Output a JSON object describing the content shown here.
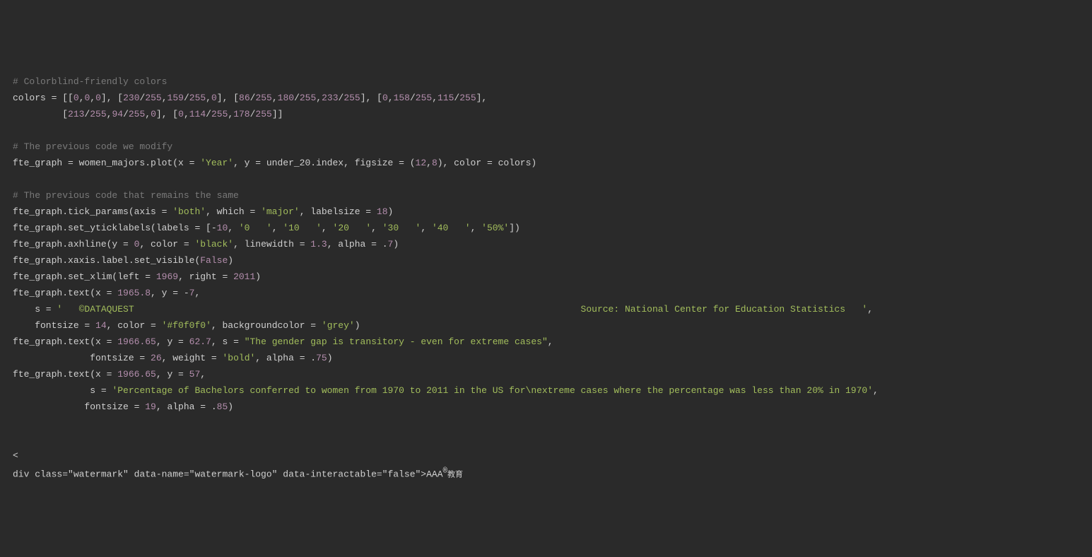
{
  "code": {
    "c1": "# Colorblind-friendly colors",
    "l2_a": "colors = [[",
    "l2_n1": "0",
    "l2_c1": ",",
    "l2_n2": "0",
    "l2_c2": ",",
    "l2_n3": "0",
    "l2_b": "], [",
    "l2_n4": "230",
    "l2_s1": "/",
    "l2_n5": "255",
    "l2_c3": ",",
    "l2_n6": "159",
    "l2_s2": "/",
    "l2_n7": "255",
    "l2_c4": ",",
    "l2_n8": "0",
    "l2_d": "], [",
    "l2_n9": "86",
    "l2_s3": "/",
    "l2_n10": "255",
    "l2_c5": ",",
    "l2_n11": "180",
    "l2_s4": "/",
    "l2_n12": "255",
    "l2_c6": ",",
    "l2_n13": "233",
    "l2_s5": "/",
    "l2_n14": "255",
    "l2_e": "], [",
    "l2_n15": "0",
    "l2_c7": ",",
    "l2_n16": "158",
    "l2_s6": "/",
    "l2_n17": "255",
    "l2_c8": ",",
    "l2_n18": "115",
    "l2_s7": "/",
    "l2_n19": "255",
    "l2_f": "],",
    "l3_pad": "         [",
    "l3_n1": "213",
    "l3_s1": "/",
    "l3_n2": "255",
    "l3_c1": ",",
    "l3_n3": "94",
    "l3_s2": "/",
    "l3_n4": "255",
    "l3_c2": ",",
    "l3_n5": "0",
    "l3_a": "], [",
    "l3_n6": "0",
    "l3_c3": ",",
    "l3_n7": "114",
    "l3_s3": "/",
    "l3_n8": "255",
    "l3_c4": ",",
    "l3_n9": "178",
    "l3_s4": "/",
    "l3_n10": "255",
    "l3_b": "]]",
    "c2": "# The previous code we modify",
    "l5_a": "fte_graph = women_majors.plot(x = ",
    "l5_str": "'Year'",
    "l5_b": ", y = under_20.index, figsize = (",
    "l5_n1": "12",
    "l5_c": ",",
    "l5_n2": "8",
    "l5_d": "), color = colors)",
    "c3": "# The previous code that remains the same",
    "l7_a": "fte_graph.tick_params(axis = ",
    "l7_s1": "'both'",
    "l7_b": ", which = ",
    "l7_s2": "'major'",
    "l7_c": ", labelsize = ",
    "l7_n": "18",
    "l7_d": ")",
    "l8_a": "fte_graph.set_yticklabels(labels = [-",
    "l8_n": "10",
    "l8_b": ", ",
    "l8_s1": "'0   '",
    "l8_c": ", ",
    "l8_s2": "'10   '",
    "l8_d": ", ",
    "l8_s3": "'20   '",
    "l8_e": ", ",
    "l8_s4": "'30   '",
    "l8_f": ", ",
    "l8_s5": "'40   '",
    "l8_g": ", ",
    "l8_s6": "'50%'",
    "l8_h": "])",
    "l9_a": "fte_graph.axhline(y = ",
    "l9_n1": "0",
    "l9_b": ", color = ",
    "l9_s": "'black'",
    "l9_c": ", linewidth = ",
    "l9_n2": "1.3",
    "l9_d": ", alpha = .",
    "l9_n3": "7",
    "l9_e": ")",
    "l10_a": "fte_graph.xaxis.label.set_visible(",
    "l10_kw": "False",
    "l10_b": ")",
    "l11_a": "fte_graph.set_xlim(left = ",
    "l11_n1": "1969",
    "l11_b": ", right = ",
    "l11_n2": "2011",
    "l11_c": ")",
    "l12_a": "fte_graph.text(x = ",
    "l12_n1": "1965.8",
    "l12_b": ", y = -",
    "l12_n2": "7",
    "l12_c": ",",
    "l13_pad": "    s = ",
    "l13_s": "'   ©DATAQUEST                                                                                 Source: National Center for Education Statistics   '",
    "l13_b": ",",
    "l14_pad": "    fontsize = ",
    "l14_n": "14",
    "l14_a": ", color = ",
    "l14_s1": "'#f0f0f0'",
    "l14_b": ", backgroundcolor = ",
    "l14_s2": "'grey'",
    "l14_c": ")",
    "l15_a": "fte_graph.text(x = ",
    "l15_n1": "1966.65",
    "l15_b": ", y = ",
    "l15_n2": "62.7",
    "l15_c": ", s = ",
    "l15_s": "\"The gender gap is transitory - even for extreme cases\"",
    "l15_d": ",",
    "l16_pad": "              fontsize = ",
    "l16_n": "26",
    "l16_a": ", weight = ",
    "l16_s": "'bold'",
    "l16_b": ", alpha = .",
    "l16_n2": "75",
    "l16_c": ")",
    "l17_a": "fte_graph.text(x = ",
    "l17_n1": "1966.65",
    "l17_b": ", y = ",
    "l17_n2": "57",
    "l17_c": ",",
    "l18_pad": "              s = ",
    "l18_s": "'Percentage of Bachelors conferred to women from 1970 to 2011 in the US for\\nextreme cases where the percentage was less than 20% in 1970'",
    "l18_b": ",",
    "l19_pad": "             fontsize = ",
    "l19_n": "19",
    "l19_a": ", alpha = .",
    "l19_n2": "85",
    "l19_b": ")"
  },
  "watermark": {
    "main": "AAA",
    "sub": "教育"
  }
}
